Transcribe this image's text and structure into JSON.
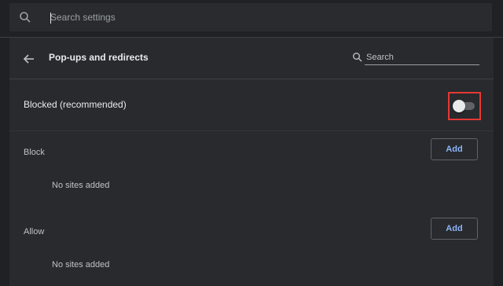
{
  "search": {
    "placeholder": "Search settings"
  },
  "page": {
    "title": "Pop-ups and redirects",
    "search_placeholder": "Search"
  },
  "blocked": {
    "label": "Blocked (recommended)",
    "toggle_on": false
  },
  "block_section": {
    "label": "Block",
    "add_label": "Add",
    "empty": "No sites added"
  },
  "allow_section": {
    "label": "Allow",
    "add_label": "Add",
    "empty": "No sites added"
  },
  "colors": {
    "highlight": "#e53935",
    "accent": "#8ab4f8"
  }
}
